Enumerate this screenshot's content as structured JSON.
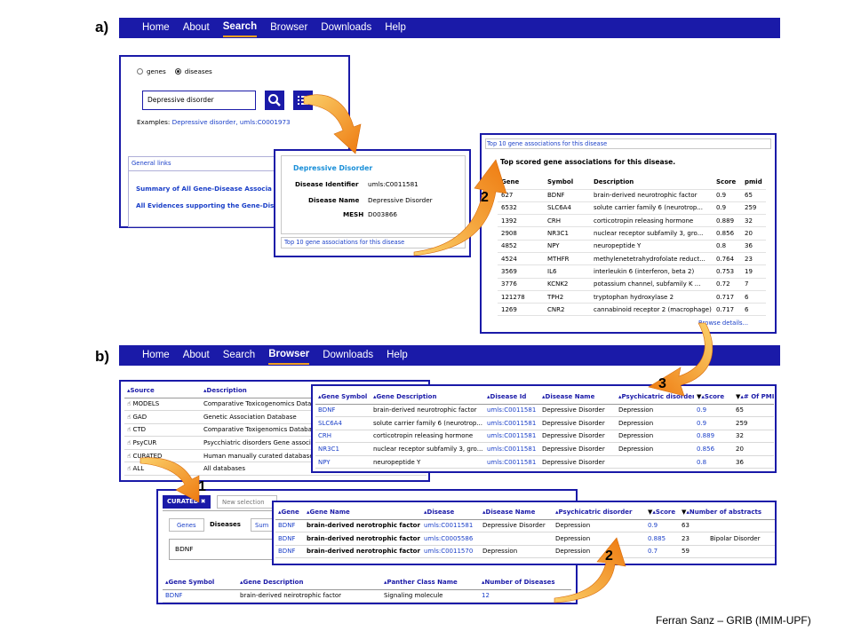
{
  "footer": "Ferran Sanz – GRIB (IMIM-UPF)",
  "colors": {
    "nav_blue": "#1a1aa8",
    "link_blue": "#1a3fc8",
    "arrow_orange": "#f28a18",
    "active_underline": "#f2a020"
  },
  "panel_a": {
    "label": "a)",
    "nav": [
      "Home",
      "About",
      "Search",
      "Browser",
      "Downloads",
      "Help"
    ],
    "search": {
      "radio_genes": "genes",
      "radio_diseases": "diseases",
      "query": "Depressive disorder",
      "examples_label": "Examples:",
      "examples_link": "Depressive disorder, umls:C0001973",
      "general_links": "General links",
      "link1": "Summary of All Gene-Disease Associa",
      "link2": "All Evidences supporting the Gene-Dise"
    },
    "disease_card": {
      "title": "Depressive Disorder",
      "id_label": "Disease Identifier",
      "id_value": "umls:C0011581",
      "name_label": "Disease Name",
      "name_value": "Depressive Disorder",
      "mesh_label": "MESH",
      "mesh_value": "D003866",
      "footer_link": "Top 10 gene associations for this disease"
    },
    "top_genes": {
      "header_link": "Top 10 gene associations for this disease",
      "heading": "Top scored gene associations for this disease.",
      "columns": [
        "Gene",
        "Symbol",
        "Description",
        "Score",
        "pmid"
      ],
      "rows": [
        [
          "627",
          "BDNF",
          "brain-derived neurotrophic factor",
          "0.9",
          "65"
        ],
        [
          "6532",
          "SLC6A4",
          "solute carrier family 6 (neurotrop...",
          "0.9",
          "259"
        ],
        [
          "1392",
          "CRH",
          "corticotropin releasing hormone",
          "0.889",
          "32"
        ],
        [
          "2908",
          "NR3C1",
          "nuclear receptor subfamily 3, gro...",
          "0.856",
          "20"
        ],
        [
          "4852",
          "NPY",
          "neuropeptide Y",
          "0.8",
          "36"
        ],
        [
          "4524",
          "MTHFR",
          "methylenetetrahydrofolate reduct...",
          "0.764",
          "23"
        ],
        [
          "3569",
          "IL6",
          "interleukin 6 (interferon, beta 2)",
          "0.753",
          "19"
        ],
        [
          "3776",
          "KCNK2",
          "potassium channel, subfamily K ...",
          "0.72",
          "7"
        ],
        [
          "121278",
          "TPH2",
          "tryptophan hydroxylase 2",
          "0.717",
          "6"
        ],
        [
          "1269",
          "CNR2",
          "cannabinoid receptor 2 (macrophage)",
          "0.717",
          "6"
        ]
      ],
      "browse_link": "Browse details..."
    },
    "step_badge": "2"
  },
  "panel_b": {
    "label": "b)",
    "nav": [
      "Home",
      "About",
      "Search",
      "Browser",
      "Downloads",
      "Help"
    ],
    "sources": {
      "columns": [
        "Source",
        "Description"
      ],
      "rows": [
        [
          "MODELS",
          "Comparative Toxicogenomics Datab"
        ],
        [
          "GAD",
          "Genetic Association Database"
        ],
        [
          "CTD",
          "Comparative Toxigenomics Databas"
        ],
        [
          "PsyCUR",
          "Psycchiatric disorders Gene associ"
        ],
        [
          "CURATED",
          "Human manually curated database"
        ],
        [
          "ALL",
          "All databases"
        ]
      ]
    },
    "assoc_table": {
      "columns": [
        "Gene Symbol",
        "Gene Description",
        "Disease Id",
        "Disease Name",
        "Psychicatric disorder",
        "Score",
        "# Of PMIDs"
      ],
      "rows": [
        [
          "BDNF",
          "brain-derived neurotrophic factor",
          "umls:C0011581",
          "Depressive Disorder",
          "Depression",
          "0.9",
          "65"
        ],
        [
          "SLC6A4",
          "solute carrier family 6 (neurotrop...",
          "umls:C0011581",
          "Depressive Disorder",
          "Depression",
          "0.9",
          "259"
        ],
        [
          "CRH",
          "corticotropin releasing hormone",
          "umls:C0011581",
          "Depressive Disorder",
          "Depression",
          "0.889",
          "32"
        ],
        [
          "NR3C1",
          "nuclear receptor subfamily 3, gro...",
          "umls:C0011581",
          "Depressive Disorder",
          "Depression",
          "0.856",
          "20"
        ],
        [
          "NPY",
          "neuropeptide Y",
          "umls:C0011581",
          "Depressive Disorder",
          "",
          "0.8",
          "36"
        ]
      ]
    },
    "curated": {
      "tab_active": "CURATED",
      "tab_new": "New selection",
      "subtabs": [
        "Genes",
        "Diseases",
        "Sum"
      ],
      "query": "BDNF"
    },
    "gene_table": {
      "columns": [
        "Gene",
        "Gene Name",
        "Disease",
        "Disease Name",
        "Psychicatric disorder",
        "Score",
        "Number of abstracts"
      ],
      "rows": [
        [
          "BDNF",
          "brain-derived nerotrophic factor",
          "umls:C0011581",
          "Depressive Disorder",
          "Depression",
          "0.9",
          "63",
          ""
        ],
        [
          "BDNF",
          "brain-derived nerotrophic factor",
          "umls:C0005586",
          "",
          "Depression",
          "0.885",
          "23",
          "Bipolar Disorder"
        ],
        [
          "BDNF",
          "brain-derived nerotrophic factor",
          "umls:C0011570",
          "Depression",
          "Depression",
          "0.7",
          "59",
          ""
        ]
      ]
    },
    "panther_table": {
      "columns": [
        "Gene Symbol",
        "Gene Description",
        "Panther Class Name",
        "Number of Diseases"
      ],
      "rows": [
        [
          "BDNF",
          "brain-derived neirotrophic factor",
          "Signaling molecule",
          "12"
        ]
      ]
    },
    "step_badges": [
      "3",
      "1",
      "2"
    ]
  }
}
